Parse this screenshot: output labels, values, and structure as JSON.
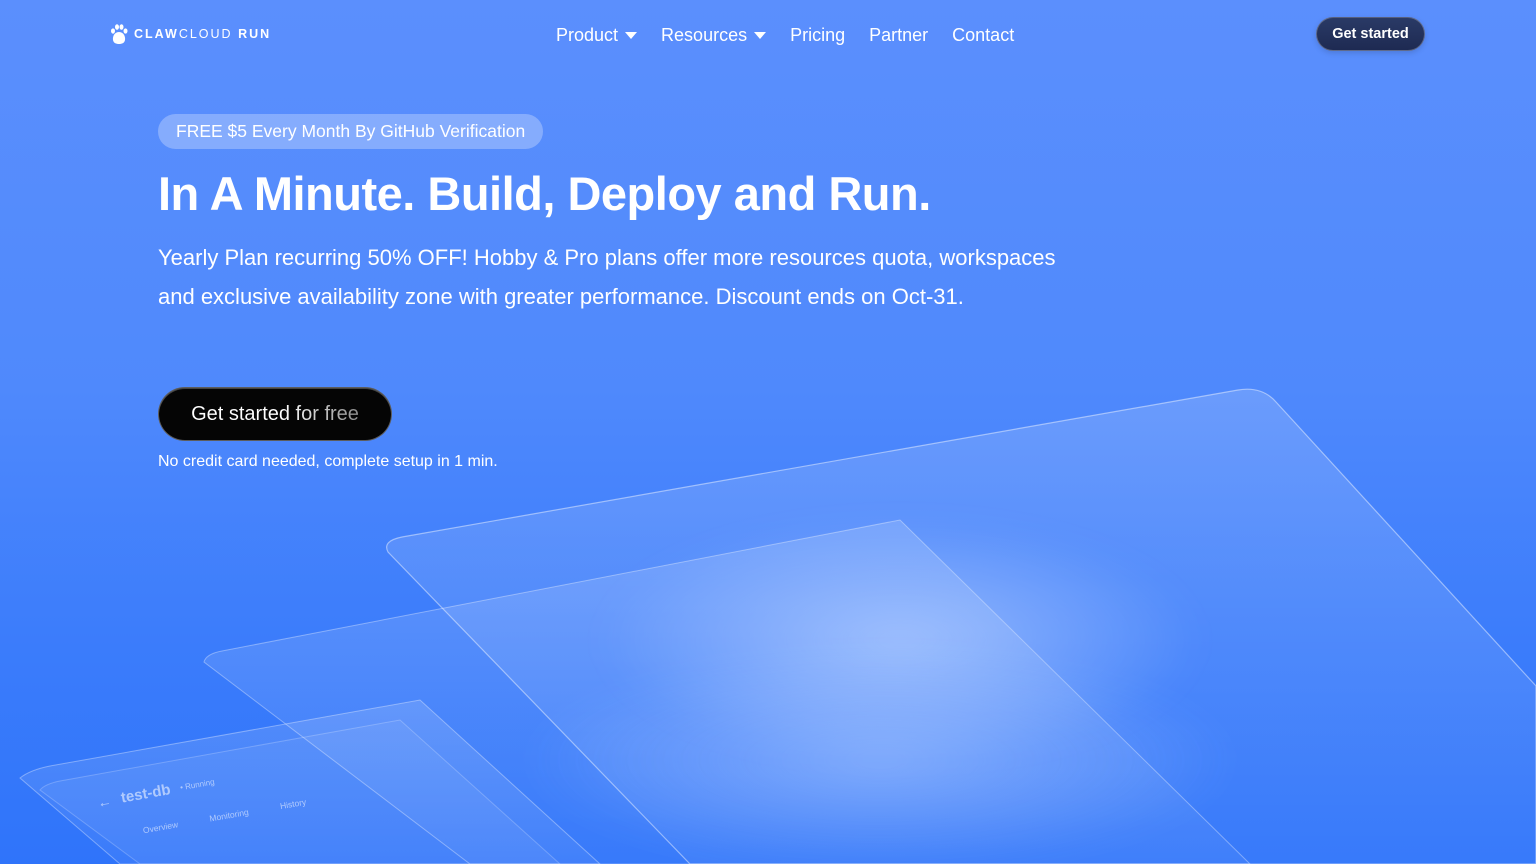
{
  "header": {
    "logo": {
      "brand_bold": "CLAW",
      "brand_light": "CLOUD",
      "brand_suffix": "RUN"
    },
    "nav": [
      {
        "label": "Product",
        "has_dropdown": true
      },
      {
        "label": "Resources",
        "has_dropdown": true
      },
      {
        "label": "Pricing",
        "has_dropdown": false
      },
      {
        "label": "Partner",
        "has_dropdown": false
      },
      {
        "label": "Contact",
        "has_dropdown": false
      }
    ],
    "cta_label": "Get started"
  },
  "hero": {
    "promo": "FREE $5 Every Month By GitHub Verification",
    "title": "In A Minute. Build, Deploy and Run.",
    "description": "Yearly Plan recurring 50% OFF! Hobby & Pro plans offer more resources quota, workspaces and exclusive availability zone with greater performance. Discount ends on Oct-31.",
    "cta_label": "Get started for free",
    "note": "No credit card needed, complete setup in 1 min."
  },
  "preview": {
    "back_icon": "arrow-left-icon",
    "db_name": "test-db",
    "status": "• Running",
    "tabs": [
      "Overview",
      "Monitoring",
      "History"
    ]
  },
  "colors": {
    "background_top": "#5b8ffd",
    "background_bottom": "#2f74fa",
    "header_cta_bg": "#1e2a52",
    "main_cta_bg": "#050505"
  }
}
